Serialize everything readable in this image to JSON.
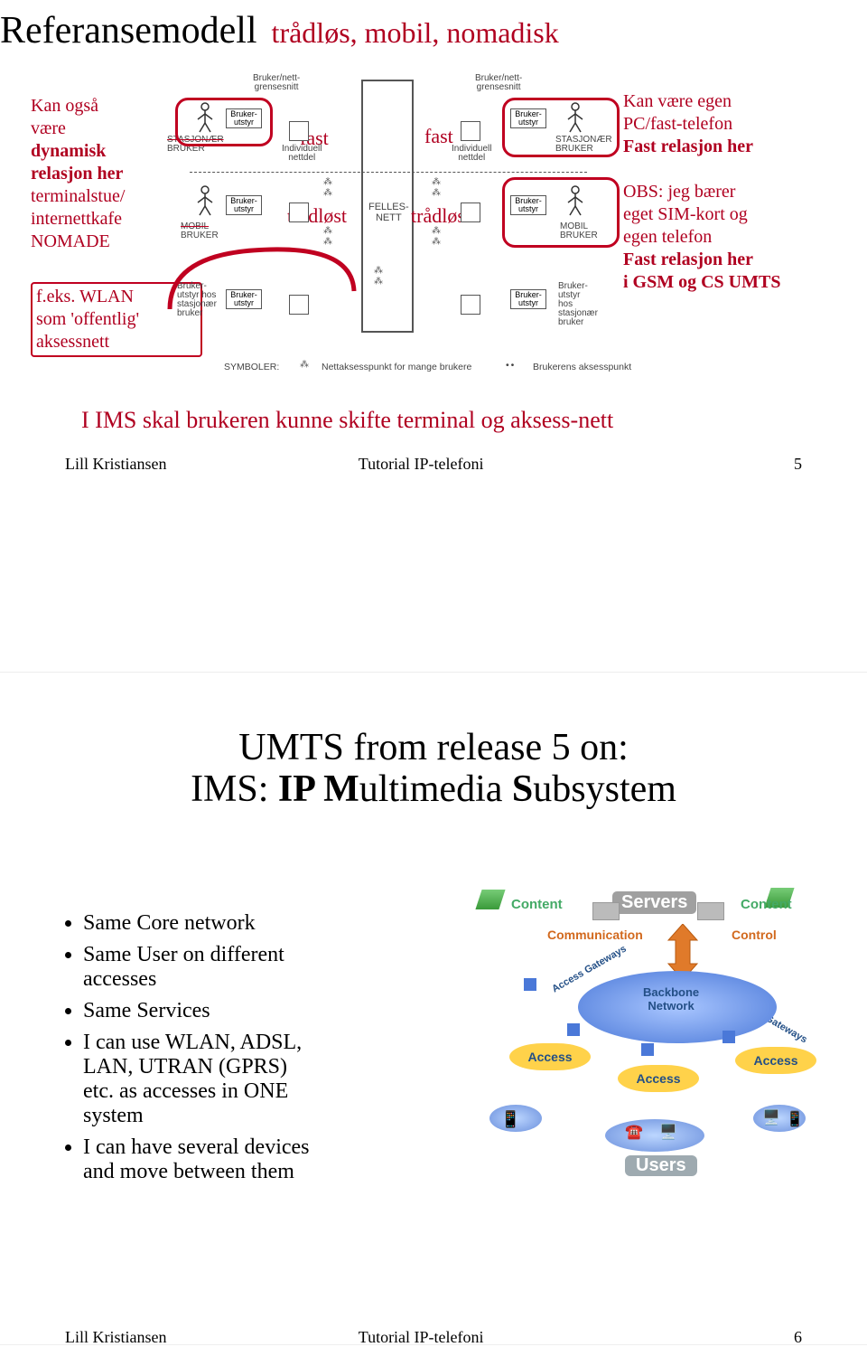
{
  "slide1": {
    "title_main": "Referansemodell",
    "title_sub": "trådløs, mobil, nomadisk",
    "left1": {
      "l1": "Kan også",
      "l2": "være",
      "l3": "dynamisk",
      "l4": "relasjon her",
      "l5": "terminalstue/",
      "l6": "internettkafe",
      "l7": "NOMADE"
    },
    "left2": {
      "l1": "f.eks. WLAN",
      "l2": "som 'offentlig'",
      "l3": "aksessnett"
    },
    "right1": {
      "l1": "Kan være egen",
      "l2": "PC/fast-telefon",
      "l3": "Fast relasjon her"
    },
    "right2": {
      "l1": "OBS: jeg bærer",
      "l2": "eget SIM-kort og",
      "l3": "egen telefon",
      "l4": "Fast relasjon her",
      "l5": "i GSM og CS UMTS"
    },
    "labels": {
      "fast": "fast",
      "tradlost": "trådløst",
      "felles1": "FELLES-",
      "felles2": "NETT",
      "bruker_nett": "Bruker/nett-",
      "grensesnitt": "grensesnitt",
      "bruker_utstyr1": "Bruker-",
      "bruker_utstyr2": "utstyr",
      "stasjonaer": "STASJONÆR",
      "mobil": "MOBIL",
      "bruker": "BRUKER",
      "hos": "hos",
      "stasjon": "stasjonær",
      "brukerword": "bruker",
      "individ1": "Individuell",
      "individ2": "nettdel",
      "symboler": "SYMBOLER:",
      "symb_many": "Nettaksesspunkt for mange brukere",
      "symb_one": "Brukerens aksesspunkt"
    },
    "conclusion": "I IMS skal brukeren kunne skifte terminal og aksess-nett",
    "footer": {
      "author": "Lill Kristiansen",
      "tutorial": "Tutorial IP-telefoni",
      "page": "5"
    }
  },
  "slide2": {
    "title_l1": "UMTS from release 5 on:",
    "title_l2_pre": "IMS: ",
    "title_l2_ip": "IP M",
    "title_l2_mid": "ultimedia ",
    "title_l2_s": "S",
    "title_l2_end": "ubsystem",
    "bullets": {
      "b1": "Same Core network",
      "b2a": "Same User on different",
      "b2b": "accesses",
      "b3": "Same Services",
      "b4a": "I can use WLAN, ADSL,",
      "b4b": "LAN, UTRAN (GPRS)",
      "b4c": "etc. as accesses  in ONE",
      "b4d": "system",
      "b5a": "I can have several devices",
      "b5b": "and move between them"
    },
    "img": {
      "content": "Content",
      "servers": "Servers",
      "communication": "Communication",
      "control": "Control",
      "access_gw": "Access Gateways",
      "backbone1": "Backbone",
      "backbone2": "Network",
      "access": "Access",
      "users": "Users"
    },
    "footer": {
      "author": "Lill Kristiansen",
      "tutorial": "Tutorial IP-telefoni",
      "page": "6"
    }
  }
}
